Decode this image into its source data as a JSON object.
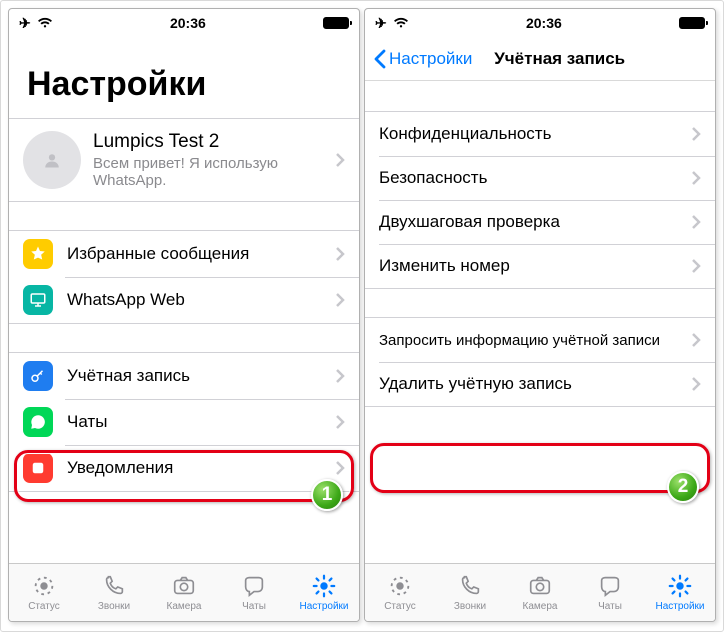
{
  "status": {
    "time": "20:36"
  },
  "left": {
    "title": "Настройки",
    "profile": {
      "name": "Lumpics Test 2",
      "status": "Всем привет! Я использую WhatsApp."
    },
    "g1": [
      {
        "label": "Избранные сообщения",
        "color": "#ffcc00",
        "icon": "star"
      },
      {
        "label": "WhatsApp Web",
        "color": "#07b6a4",
        "icon": "monitor"
      }
    ],
    "g2": [
      {
        "label": "Учётная запись",
        "color": "#1f7df0",
        "icon": "key"
      },
      {
        "label": "Чаты",
        "color": "#00d757",
        "icon": "bubble"
      },
      {
        "label": "Уведомления",
        "color": "#ff3b30",
        "icon": "square"
      }
    ]
  },
  "right": {
    "back": "Настройки",
    "title": "Учётная запись",
    "s1": [
      "Конфиденциальность",
      "Безопасность",
      "Двухшаговая проверка",
      "Изменить номер"
    ],
    "s2": [
      "Запросить информацию учётной записи",
      "Удалить учётную запись"
    ]
  },
  "tabs": [
    {
      "label": "Статус"
    },
    {
      "label": "Звонки"
    },
    {
      "label": "Камера"
    },
    {
      "label": "Чаты"
    },
    {
      "label": "Настройки"
    }
  ],
  "badges": {
    "one": "1",
    "two": "2"
  }
}
